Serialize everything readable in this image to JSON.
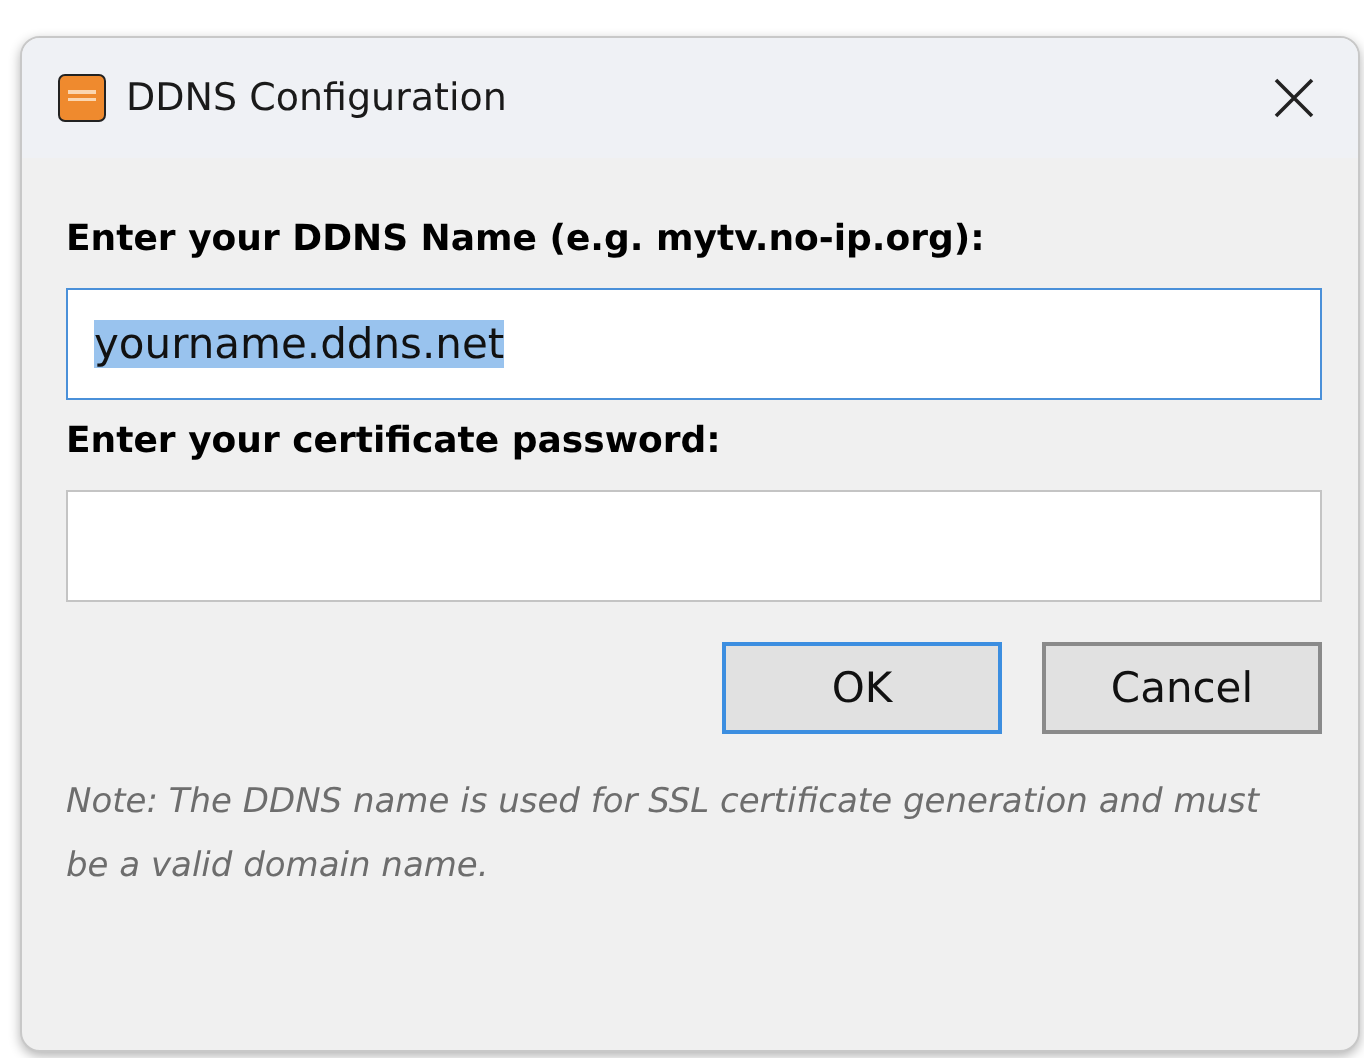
{
  "window": {
    "title": "DDNS Configuration"
  },
  "fields": [
    {
      "label": "Enter your DDNS Name (e.g. mytv.no-ip.org):",
      "value": "yourname.ddns.net",
      "focused": true,
      "text_selected": true
    },
    {
      "label": "Enter your certificate password:",
      "focused": false
    }
  ],
  "buttons": [
    {
      "label": "OK",
      "default": true
    },
    {
      "label": "Cancel",
      "default": false
    }
  ],
  "note": "Note: The DDNS name is used for SSL certificate generation and must be a valid domain name."
}
